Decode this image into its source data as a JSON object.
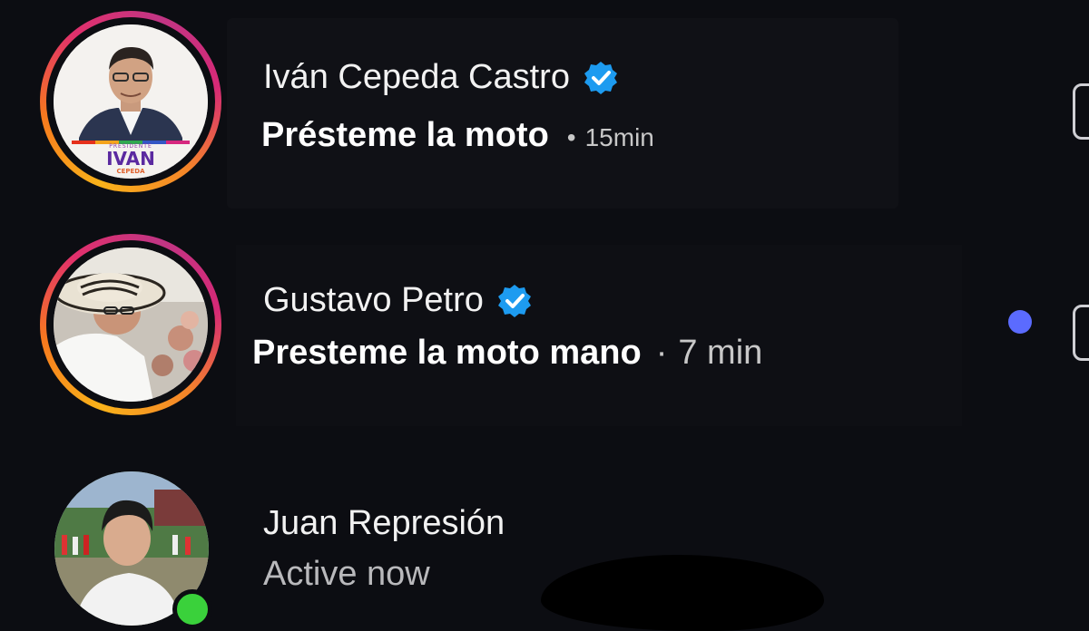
{
  "conversations": [
    {
      "name": "Iván Cepeda Castro",
      "verified": true,
      "message": "Présteme la moto",
      "separator": "•",
      "time": "15min",
      "avatar_badge_small": "PRESIDENTE",
      "avatar_badge_main": "IVAN",
      "avatar_badge_sub": "CEPEDA",
      "story_ring": true
    },
    {
      "name": "Gustavo Petro",
      "verified": true,
      "message": "Presteme la moto mano",
      "separator": "·",
      "time": "7 min",
      "unread": true,
      "story_ring": true
    },
    {
      "name": "Juan Represión",
      "status": "Active now",
      "online": true
    }
  ],
  "colors": {
    "background": "#0c0d12",
    "verified_badge": "#1d9bf0",
    "unread_dot": "#5b6bff",
    "online_dot": "#3ad13b"
  },
  "icons": {
    "verified": "verified-badge-icon",
    "camera": "camera-icon"
  }
}
